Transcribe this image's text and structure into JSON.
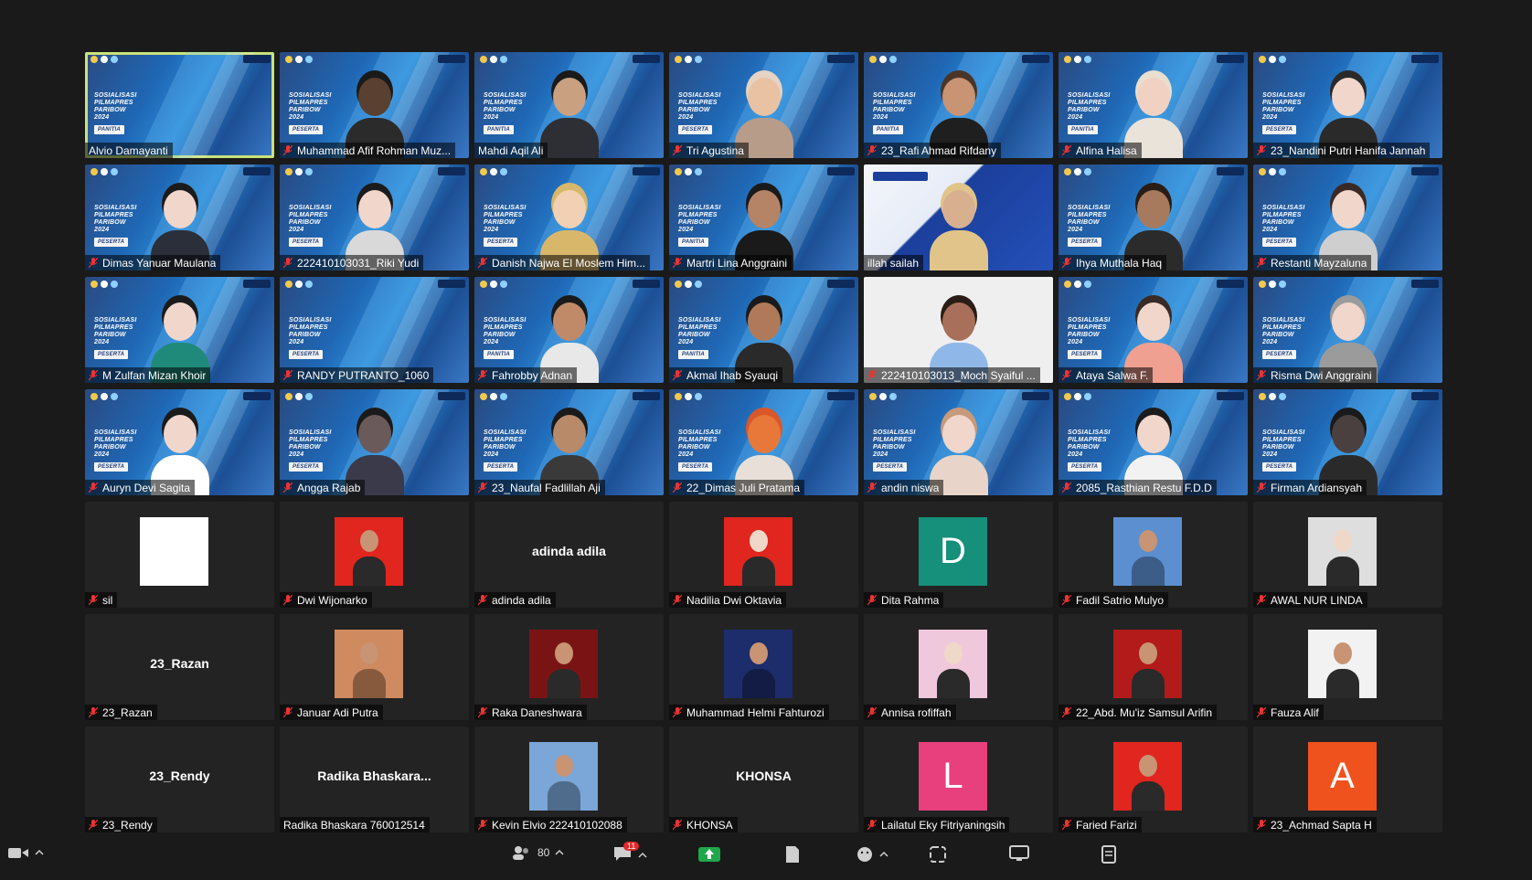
{
  "participants": [
    {
      "name": "Alvio Damayanti",
      "kind": "video",
      "role": "PANITIA",
      "active": true,
      "muted": false,
      "skin": "none"
    },
    {
      "name": "Muhammad Afif Rohman Muz...",
      "kind": "video",
      "role": "PESERTA",
      "muted": true,
      "skin": "#5a4030",
      "hair": "#1a1a1a",
      "shirt": "#2b2b2b"
    },
    {
      "name": "Mahdi Aqil Ali",
      "kind": "video",
      "role": "PANITIA",
      "muted": false,
      "skin": "#c9a080",
      "hair": "#1a1a1a",
      "shirt": "#2e2e35"
    },
    {
      "name": "Tri Agustina",
      "kind": "video",
      "role": "PESERTA",
      "muted": true,
      "skin": "#e9c2a4",
      "hair": "#e6d3c4",
      "shirt": "#b89c8a"
    },
    {
      "name": "23_Rafi Ahmad Rifdany",
      "kind": "video",
      "role": "PANITIA",
      "muted": true,
      "skin": "#c89474",
      "hair": "#4b3526",
      "shirt": "#1f1f1f"
    },
    {
      "name": "Alfina Halisa",
      "kind": "video",
      "role": "PANITIA",
      "muted": true,
      "skin": "#f1d2c2",
      "hair": "#e8dfcf",
      "shirt": "#e9e3da"
    },
    {
      "name": "23_Nandini Putri Hanifa Jannah",
      "kind": "video",
      "role": "PESERTA",
      "muted": true,
      "skin": "#f1d6cb",
      "hair": "#2a2a2a",
      "shirt": "#2a2a2a"
    },
    {
      "name": "Dimas Yanuar Maulana",
      "kind": "video",
      "role": "PESERTA",
      "muted": true,
      "skin": "#f1d6cb",
      "hair": "#1b1b1b",
      "shirt": "#2a2f3a"
    },
    {
      "name": "222410103031_Riki Yudi",
      "kind": "video",
      "role": "PESERTA",
      "muted": true,
      "skin": "#f1d6cb",
      "hair": "#1b1b1b",
      "shirt": "#d9d9d9"
    },
    {
      "name": "Danish Najwa El Moslem Him...",
      "kind": "video",
      "role": "PESERTA",
      "muted": true,
      "skin": "#f1d0b4",
      "hair": "#d9b76a",
      "shirt": "#d9b76a"
    },
    {
      "name": "Martri Lina Anggraini",
      "kind": "video",
      "role": "PANITIA",
      "muted": true,
      "skin": "#b58366",
      "hair": "#1a1a1a",
      "shirt": "#1a1a1a"
    },
    {
      "name": "illah sailah",
      "kind": "ipb",
      "role": "",
      "muted": false,
      "skin": "#d8b090",
      "hair": "#e1c48a",
      "shirt": "#e1c48a"
    },
    {
      "name": "Ihya Muthala Haq",
      "kind": "video",
      "role": "PESERTA",
      "muted": true,
      "skin": "#a77a5e",
      "hair": "#2a1d15",
      "shirt": "#2b2b2b"
    },
    {
      "name": "Restanti Mayzaluna",
      "kind": "video",
      "role": "PESERTA",
      "muted": true,
      "skin": "#f1d6cb",
      "hair": "#3a2a25",
      "shirt": "#cfcfcf"
    },
    {
      "name": "M Zulfan Mizan Khoir",
      "kind": "video",
      "role": "PESERTA",
      "muted": true,
      "skin": "#f1d6cb",
      "hair": "#1b1b1b",
      "shirt": "#1f8a7a"
    },
    {
      "name": "RANDY PUTRANTO_1060",
      "kind": "video",
      "role": "PESERTA",
      "muted": true,
      "skin": "none"
    },
    {
      "name": "Fahrobby Adnan",
      "kind": "video",
      "role": "PANITIA",
      "muted": true,
      "skin": "#c08a68",
      "hair": "#1a1a1a",
      "shirt": "#e8e8e8"
    },
    {
      "name": "Akmal Ihab Syauqi",
      "kind": "video",
      "role": "PANITIA",
      "muted": true,
      "skin": "#b07a5a",
      "hair": "#1a1a1a",
      "shirt": "#2a2a2a"
    },
    {
      "name": "222410103013_Moch Syaiful ...",
      "kind": "plain",
      "role": "",
      "muted": true,
      "skin": "#a8705a",
      "hair": "#2a1d15",
      "shirt": "#8fb8e8"
    },
    {
      "name": "Ataya Salwa F.",
      "kind": "video",
      "role": "PESERTA",
      "muted": true,
      "skin": "#f1d6cb",
      "hair": "#3a2a25",
      "shirt": "#f0a090"
    },
    {
      "name": "Risma Dwi Anggraini",
      "kind": "video",
      "role": "PESERTA",
      "muted": true,
      "skin": "#f1d6cb",
      "hair": "#9b9b9b",
      "shirt": "#9b9b9b"
    },
    {
      "name": "Auryn Devi Sagita",
      "kind": "video",
      "role": "PESERTA",
      "muted": true,
      "skin": "#f1d6cb",
      "hair": "#1b1b1b",
      "shirt": "#ffffff"
    },
    {
      "name": "Angga Rajab",
      "kind": "video",
      "role": "PESERTA",
      "muted": true,
      "skin": "#6b5a5a",
      "hair": "#1a1a1a",
      "shirt": "#3a3a4a"
    },
    {
      "name": "23_Naufal Fadlillah Aji",
      "kind": "video",
      "role": "PESERTA",
      "muted": true,
      "skin": "#b88a6a",
      "hair": "#1a1a1a",
      "shirt": "#3a3a3a"
    },
    {
      "name": "22_Dimas Juli Pratama",
      "kind": "video",
      "role": "PESERTA",
      "muted": true,
      "skin": "#e8783a",
      "hair": "#d9572a",
      "shirt": "#e8e0d8"
    },
    {
      "name": "andin niswa",
      "kind": "video",
      "role": "PESERTA",
      "muted": true,
      "skin": "#f1d6cb",
      "hair": "#c69a7a",
      "shirt": "#e8d4c8"
    },
    {
      "name": "2085_Rasthian Restu F.D.D",
      "kind": "video",
      "role": "PESERTA",
      "muted": true,
      "skin": "#f1d6cb",
      "hair": "#1b1b1b",
      "shirt": "#f2f2f2"
    },
    {
      "name": "Firman Ardiansyah",
      "kind": "video",
      "role": "PESERTA",
      "muted": true,
      "skin": "#4a4040",
      "hair": "#1a1a1a",
      "shirt": "#2a2a2a"
    },
    {
      "name": "sil",
      "kind": "thumb",
      "thumb": "#ffffff",
      "muted": true
    },
    {
      "name": "Dwi Wijonarko",
      "kind": "thumb",
      "thumb": "#e0261e",
      "thumbType": "photo-red",
      "muted": true
    },
    {
      "name": "adinda adila",
      "kind": "text",
      "big": "adinda adila",
      "muted": true
    },
    {
      "name": "Nadilia Dwi Oktavia",
      "kind": "thumb",
      "thumb": "#e0261e",
      "thumbType": "photo-red-hijab",
      "muted": true
    },
    {
      "name": "Dita Rahma",
      "kind": "letter",
      "letter": "D",
      "thumb": "#16907a",
      "muted": true
    },
    {
      "name": "Fadil Satrio Mulyo",
      "kind": "thumb",
      "thumb": "#5b8fd0",
      "thumbType": "beach",
      "muted": true
    },
    {
      "name": "AWAL NUR LINDA",
      "kind": "thumb",
      "thumb": "#dedede",
      "thumbType": "hijab-dark",
      "muted": true
    },
    {
      "name": "23_Razan",
      "kind": "text",
      "big": "23_Razan",
      "muted": true
    },
    {
      "name": "Januar Adi Putra",
      "kind": "thumb",
      "thumb": "#d08a60",
      "thumbType": "sunset",
      "muted": true
    },
    {
      "name": "Raka Daneshwara",
      "kind": "thumb",
      "thumb": "#7a1414",
      "thumbType": "anime",
      "muted": true
    },
    {
      "name": "Muhammad Helmi Fahturozi",
      "kind": "thumb",
      "thumb": "#1d2c6a",
      "thumbType": "neon",
      "muted": true
    },
    {
      "name": "Annisa rofiffah",
      "kind": "thumb",
      "thumb": "#f0c8dc",
      "thumbType": "hijab-pink",
      "muted": true
    },
    {
      "name": "22_Abd. Mu'iz Samsul Arifin",
      "kind": "thumb",
      "thumb": "#b31b1b",
      "thumbType": "photo-formal",
      "muted": true
    },
    {
      "name": "Fauza Alif",
      "kind": "thumb",
      "thumb": "#f2f2f2",
      "thumbType": "peace",
      "muted": true
    },
    {
      "name": "23_Rendy",
      "kind": "text",
      "big": "23_Rendy",
      "muted": true
    },
    {
      "name": "Radika Bhaskara 760012514",
      "kind": "text",
      "big": "Radika  Bhaskara...",
      "muted": false
    },
    {
      "name": "Kevin Elvio 222410102088",
      "kind": "thumb",
      "thumb": "#7aa6d8",
      "thumbType": "outdoor",
      "muted": true
    },
    {
      "name": "KHONSA",
      "kind": "text",
      "big": "KHONSA",
      "muted": true
    },
    {
      "name": "Lailatul Eky Fitriyaningsih",
      "kind": "letter",
      "letter": "L",
      "thumb": "#e8407c",
      "muted": true
    },
    {
      "name": "Faried Farizi",
      "kind": "thumb",
      "thumb": "#e0261e",
      "thumbType": "photo-red2",
      "muted": true
    },
    {
      "name": "23_Achmad Sapta H",
      "kind": "letter",
      "letter": "A",
      "thumb": "#f0521e",
      "muted": true
    }
  ],
  "poster": {
    "line1": "SOSIALISASI",
    "line2": "PILMAPRES",
    "line3": "PARIBOW",
    "line4": "2024"
  },
  "toolbar": {
    "participants_count": "80",
    "chat_badge": "11"
  }
}
